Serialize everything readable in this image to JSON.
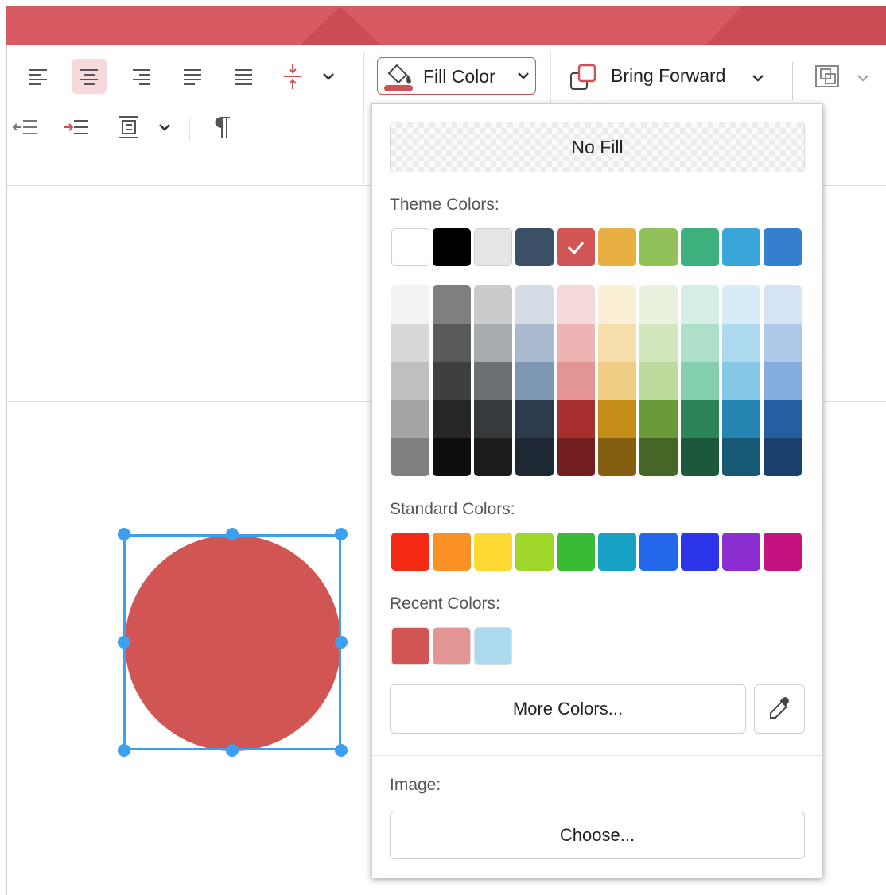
{
  "toolbar": {
    "fill_color_label": "Fill Color",
    "bring_forward_label": "Bring Forward",
    "accent": "#d14f55",
    "icons": [
      "align-left-icon",
      "align-center-icon",
      "align-right-icon",
      "justify-icon",
      "distribute-icon",
      "line-spacing-icon",
      "chevron-down-icon",
      "decrease-indent-icon",
      "increase-indent-icon",
      "text-direction-icon",
      "paragraph-mark-icon",
      "paint-bucket-icon",
      "bring-forward-icon",
      "group-icon"
    ]
  },
  "fill_menu": {
    "no_fill_label": "No Fill",
    "theme_colors_label": "Theme Colors:",
    "theme_colors": [
      "#ffffff",
      "#000000",
      "#e4e5e7",
      "#3b4f66",
      "#d15553",
      "#e8b042",
      "#92c05b",
      "#3db07d",
      "#38a6d8",
      "#367fcc"
    ],
    "selected_theme_index": 4,
    "tint_columns": [
      [
        "#f2f2f2",
        "#d8d8d8",
        "#bfbfbf",
        "#a5a5a5",
        "#7f7f7f"
      ],
      [
        "#7f7f7f",
        "#595959",
        "#3f3f3f",
        "#262626",
        "#0d0d0d"
      ],
      [
        "#cacbcd",
        "#a8abae",
        "#6c7176",
        "#363a3d",
        "#1b1d1f"
      ],
      [
        "#d4dce6",
        "#a9b9ce",
        "#7e97b3",
        "#2d3c4d",
        "#1e2834"
      ],
      [
        "#f5d8d8",
        "#edb4b3",
        "#e39594",
        "#a72f2e",
        "#721e1f"
      ],
      [
        "#faeed5",
        "#f5ddac",
        "#f0cd84",
        "#c48d18",
        "#845f0f"
      ],
      [
        "#e9f2de",
        "#d3e6bd",
        "#bddb9d",
        "#6b9a3a",
        "#466627"
      ],
      [
        "#d6efe4",
        "#addfc9",
        "#84d0ae",
        "#2c8459",
        "#1d583c"
      ],
      [
        "#d6ecf7",
        "#add9ef",
        "#85c7e7",
        "#2385b0",
        "#175975"
      ],
      [
        "#d6e3f4",
        "#adc8e9",
        "#85acde",
        "#265f9f",
        "#19406b"
      ]
    ],
    "standard_colors_label": "Standard Colors:",
    "standard_colors": [
      "#f52a15",
      "#fc9125",
      "#fdd934",
      "#9ed629",
      "#3abb36",
      "#17a2c3",
      "#2469ec",
      "#2c35ea",
      "#8a2ed1",
      "#c4137f"
    ],
    "recent_colors_label": "Recent Colors:",
    "recent_colors": [
      "#d15553",
      "#e39594",
      "#add9ef"
    ],
    "more_colors_label": "More Colors...",
    "image_label": "Image:",
    "choose_label": "Choose..."
  },
  "canvas": {
    "shape_fill": "#d15553",
    "selection_color": "#3aa0ef"
  }
}
